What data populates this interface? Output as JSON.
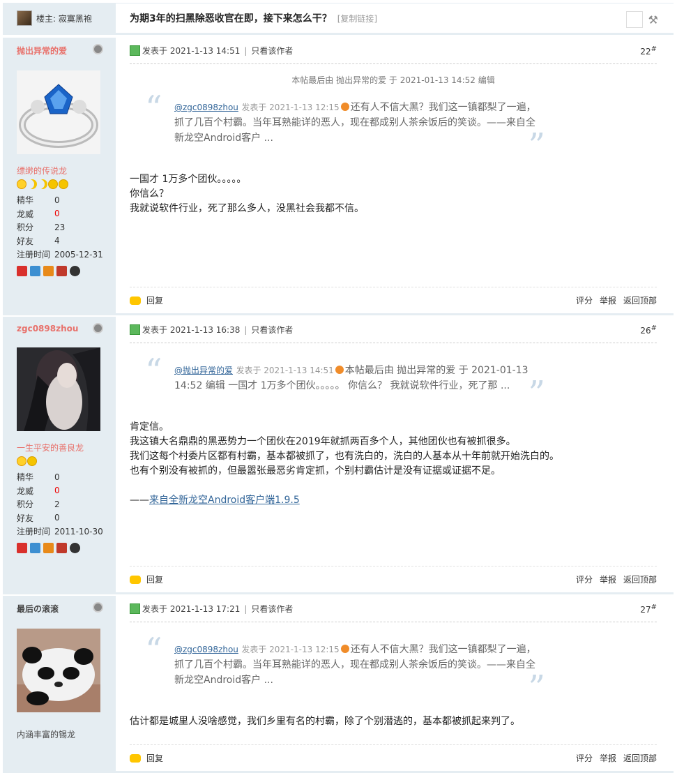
{
  "header": {
    "author_label": "楼主: 寂寞黑袍",
    "title": "为期3年的扫黑除恶收官在即，接下来怎么干？",
    "copy_link": "[复制链接]"
  },
  "common": {
    "posted_prefix": "发表于",
    "only_author": "只看该作者",
    "reply": "回复",
    "rate": "评分",
    "report": "举报",
    "back_top": "返回顶部",
    "stat_labels": [
      "精华",
      "龙威",
      "积分",
      "好友",
      "注册时间"
    ]
  },
  "posts": [
    {
      "username": "抛出异常的爱",
      "username_color": "#e8716b",
      "rank": "缥缈的传说龙",
      "stats": [
        "0",
        "0",
        "23",
        "4",
        "2005-12-31"
      ],
      "time": "2021-1-13 14:51",
      "floor": "22",
      "edit_note": "本帖最后由 抛出异常的爱 于 2021-01-13 14:52 编辑",
      "quote_user": "@zgc0898zhou",
      "quote_meta": "发表于 2021-1-13 12:15",
      "quote_text": "还有人不信大黑？我们这一镇都梨了一遍，抓了几百个村霸。当年耳熟能详的恶人，现在都成别人茶余饭后的笑谈。——来自全新龙空Android客户 ...",
      "body": [
        "一国才 1万多个团伙。。。。。",
        "你信么？",
        "我就说软件行业，死了那么多人，没黑社会我都不信。"
      ]
    },
    {
      "username": "zgc0898zhou",
      "username_color": "#e8716b",
      "rank": "一生平安的善良龙",
      "stats": [
        "0",
        "0",
        "2",
        "0",
        "2011-10-30"
      ],
      "time": "2021-1-13 16:38",
      "floor": "26",
      "quote_user": "@抛出异常的爱",
      "quote_meta": "发表于 2021-1-13 14:51",
      "quote_text": "本帖最后由 抛出异常的爱 于 2021-01-13 14:52 编辑 一国才 1万多个团伙。。。。。 你信么？ 我就说软件行业，死了那 ...",
      "body": [
        "肯定信。",
        "我这镇大名鼎鼎的黑恶势力一个团伙在2019年就抓两百多个人，其他团伙也有被抓很多。",
        "我们这每个村委片区都有村霸，基本都被抓了，也有洗白的，洗白的人基本从十年前就开始洗白的。",
        "也有个别没有被抓的，但最嚣张最恶劣肯定抓，个别村霸估计是没有证据或证据不足。"
      ],
      "signature_prefix": "——",
      "signature_link": "来自全新龙空Android客户端1.9.5"
    },
    {
      "username": "最后の滚滚",
      "username_color": "#444444",
      "rank": "内涵丰富的锡龙",
      "time": "2021-1-13 17:21",
      "floor": "27",
      "quote_user": "@zgc0898zhou",
      "quote_meta": "发表于 2021-1-13 12:15",
      "quote_text": "还有人不信大黑？我们这一镇都梨了一遍，抓了几百个村霸。当年耳熟能详的恶人，现在都成别人茶余饭后的笑谈。——来自全新龙空Android客户 ...",
      "body": [
        "估计都是城里人没啥感觉，我们乡里有名的村霸，除了个别潜逃的，基本都被抓起来判了。"
      ]
    }
  ]
}
